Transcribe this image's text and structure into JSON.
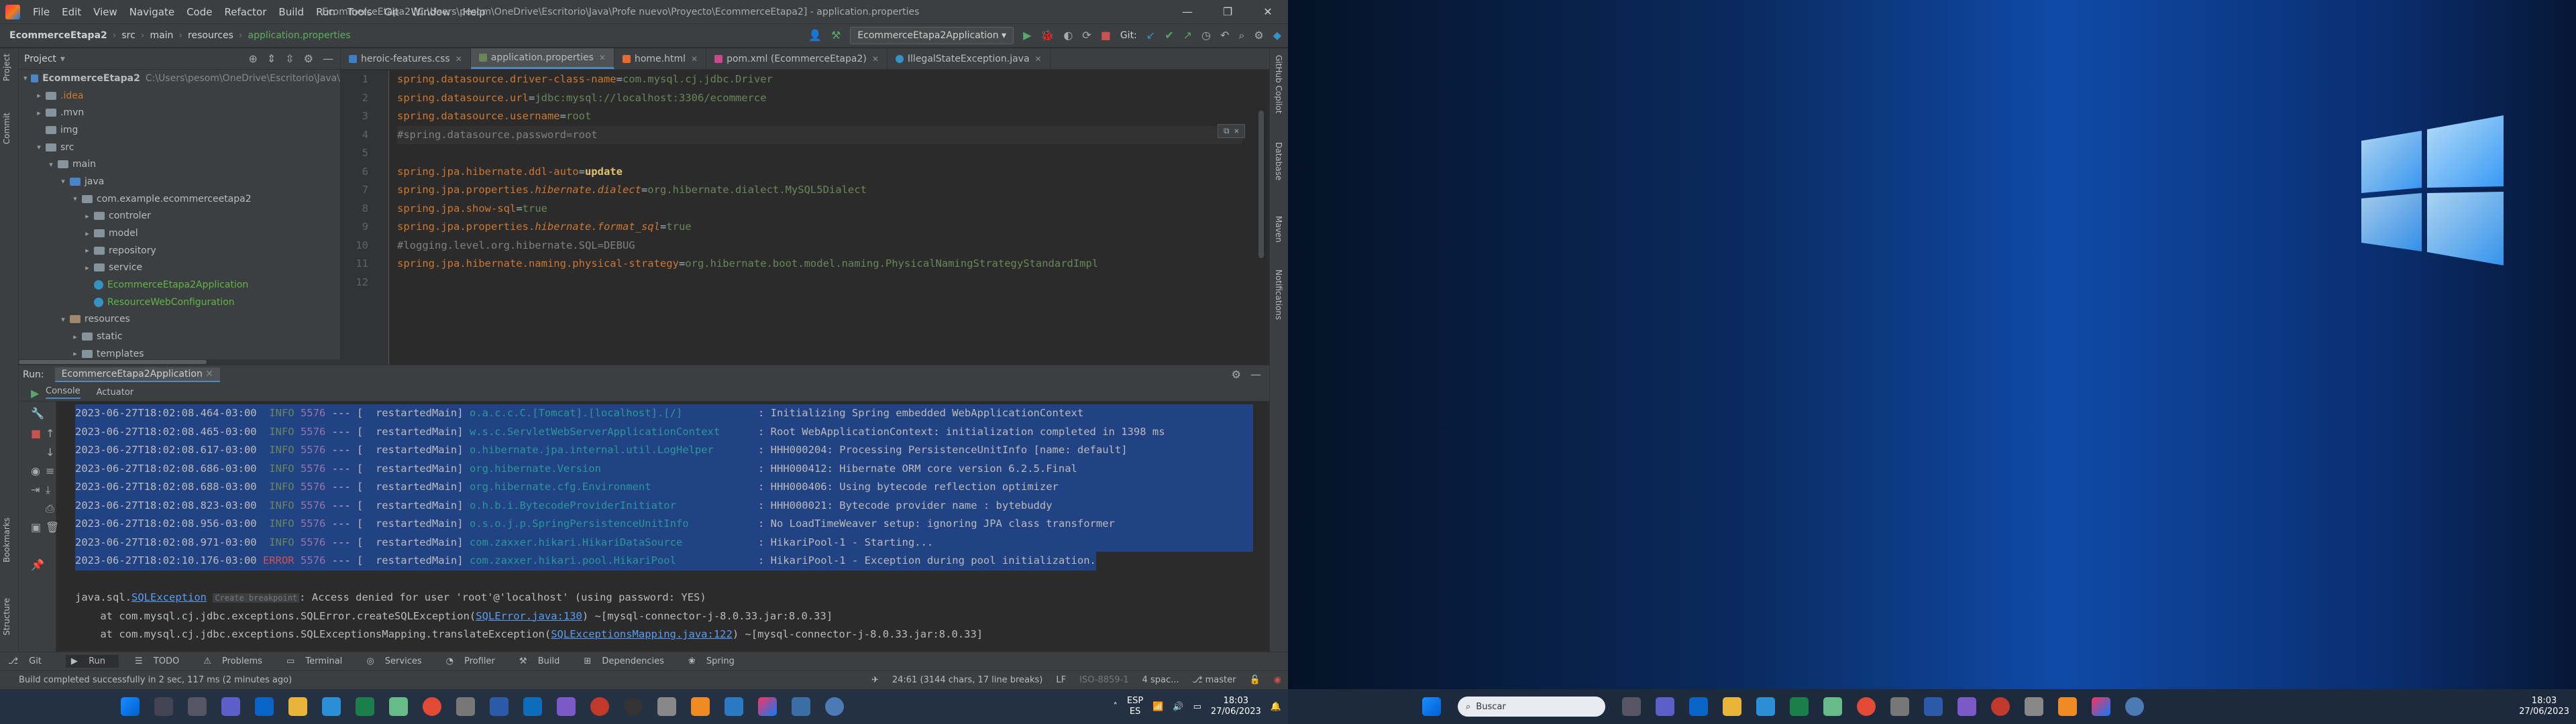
{
  "title_bar": {
    "menu": [
      "File",
      "Edit",
      "View",
      "Navigate",
      "Code",
      "Refactor",
      "Build",
      "Run",
      "Tools",
      "Git",
      "Window",
      "Help"
    ],
    "window_title": "EcommerceEtapa2 [C:\\Users\\pesom\\OneDrive\\Escritorio\\Java\\Profe nuevo\\Proyecto\\EcommerceEtapa2] - application.properties",
    "controls": [
      "—",
      "❐",
      "✕"
    ]
  },
  "navbar": {
    "breadcrumb": [
      "EcommerceEtapa2",
      "src",
      "main",
      "resources",
      "application.properties"
    ],
    "run_config": "EcommerceEtapa2Application",
    "git_label": "Git:"
  },
  "left_strip": [
    "Project",
    "Commit",
    "Bookmarks",
    "Structure"
  ],
  "right_strip": [
    "GitHub Copilot",
    "Database",
    "Maven",
    "Notifications"
  ],
  "project": {
    "title": "Project",
    "root": "EcommerceEtapa2",
    "root_path": "C:\\Users\\pesom\\OneDrive\\Escritorio\\Java\\",
    "items": [
      {
        "label": ".idea"
      },
      {
        "label": ".mvn"
      },
      {
        "label": "img"
      },
      {
        "label": "src"
      },
      {
        "label": "main"
      },
      {
        "label": "java"
      },
      {
        "label": "com.example.ecommerceetapa2"
      },
      {
        "label": "controler"
      },
      {
        "label": "model"
      },
      {
        "label": "repository"
      },
      {
        "label": "service"
      },
      {
        "label": "EcommerceEtapa2Application"
      },
      {
        "label": "ResourceWebConfiguration"
      },
      {
        "label": "resources"
      },
      {
        "label": "static"
      },
      {
        "label": "templates"
      }
    ]
  },
  "editor": {
    "tabs": [
      {
        "label": "heroic-features.css"
      },
      {
        "label": "application.properties"
      },
      {
        "label": "home.html"
      },
      {
        "label": "pom.xml (EcommerceEtapa2)"
      },
      {
        "label": "IllegalStateException.java"
      }
    ],
    "line_numbers": [
      "1",
      "2",
      "3",
      "4",
      "5",
      "6",
      "7",
      "8",
      "9",
      "10",
      "11",
      "12"
    ],
    "lines": [
      {
        "key": "spring.datasource.driver-class-name",
        "val": "com.mysql.cj.jdbc.Driver"
      },
      {
        "key": "spring.datasource.url",
        "val": "jdbc:mysql://localhost:3306/ecommerce"
      },
      {
        "key": "spring.datasource.username",
        "val": "root"
      },
      {
        "comment": "#spring.datasource.password=root"
      },
      {},
      {
        "key": "spring.jpa.hibernate.ddl-auto",
        "val": "update",
        "valbold": true
      },
      {
        "key": "spring.jpa.properties.",
        "keyital": "hibernate.dialect",
        "val": "org.hibernate.dialect.MySQL5Dialect"
      },
      {
        "key": "spring.jpa.show-sql",
        "val": "true"
      },
      {
        "key": "spring.jpa.properties.",
        "keyital": "hibernate.format_sql",
        "val": "true"
      },
      {
        "comment": "#logging.level.org.hibernate.SQL=DEBUG"
      },
      {
        "key": "spring.jpa.hibernate.naming.physical-strategy",
        "val": "org.hibernate.boot.model.naming.PhysicalNamingStrategyStandardImpl"
      },
      {}
    ]
  },
  "run": {
    "label": "Run:",
    "tab": "EcommerceEtapa2Application",
    "subtabs": [
      "Console",
      "Actuator"
    ],
    "log": [
      {
        "ts": "2023-06-27T18:02:08.464-03:00",
        "lvl": "INFO",
        "pid": "5576",
        "thr": "restartedMain",
        "logger": "o.a.c.c.C.[Tomcat].[localhost].[/]",
        "msg": ": Initializing Spring embedded WebApplicationContext"
      },
      {
        "ts": "2023-06-27T18:02:08.465-03:00",
        "lvl": "INFO",
        "pid": "5576",
        "thr": "restartedMain",
        "logger": "w.s.c.ServletWebServerApplicationContext",
        "msg": ": Root WebApplicationContext: initialization completed in 1398 ms"
      },
      {
        "ts": "2023-06-27T18:02:08.617-03:00",
        "lvl": "INFO",
        "pid": "5576",
        "thr": "restartedMain",
        "logger": "o.hibernate.jpa.internal.util.LogHelper",
        "msg": ": HHH000204: Processing PersistenceUnitInfo [name: default]"
      },
      {
        "ts": "2023-06-27T18:02:08.686-03:00",
        "lvl": "INFO",
        "pid": "5576",
        "thr": "restartedMain",
        "logger": "org.hibernate.Version",
        "msg": ": HHH000412: Hibernate ORM core version 6.2.5.Final"
      },
      {
        "ts": "2023-06-27T18:02:08.688-03:00",
        "lvl": "INFO",
        "pid": "5576",
        "thr": "restartedMain",
        "logger": "org.hibernate.cfg.Environment",
        "msg": ": HHH000406: Using bytecode reflection optimizer"
      },
      {
        "ts": "2023-06-27T18:02:08.823-03:00",
        "lvl": "INFO",
        "pid": "5576",
        "thr": "restartedMain",
        "logger": "o.h.b.i.BytecodeProviderInitiator",
        "msg": ": HHH000021: Bytecode provider name : bytebuddy"
      },
      {
        "ts": "2023-06-27T18:02:08.956-03:00",
        "lvl": "INFO",
        "pid": "5576",
        "thr": "restartedMain",
        "logger": "o.s.o.j.p.SpringPersistenceUnitInfo",
        "msg": ": No LoadTimeWeaver setup: ignoring JPA class transformer"
      },
      {
        "ts": "2023-06-27T18:02:08.971-03:00",
        "lvl": "INFO",
        "pid": "5576",
        "thr": "restartedMain",
        "logger": "com.zaxxer.hikari.HikariDataSource",
        "msg": ": HikariPool-1 - Starting..."
      },
      {
        "ts": "2023-06-27T18:02:10.176-03:00",
        "lvl": "ERROR",
        "pid": "5576",
        "thr": "restartedMain",
        "logger": "com.zaxxer.hikari.pool.HikariPool",
        "msg": ": HikariPool-1 - Exception during pool initialization."
      }
    ],
    "exception": {
      "prefix": "java.sql.",
      "cls": "SQLException",
      "bp": "Create breakpoint",
      "msg": ": Access denied for user 'root'@'localhost' (using password: YES)",
      "at1_pre": "    at com.mysql.cj.jdbc.exceptions.SQLError.createSQLException(",
      "at1_link": "SQLError.java:130",
      "at1_post": ") ~[mysql-connector-j-8.0.33.jar:8.0.33]",
      "at2_pre": "    at com.mysql.cj.jdbc.exceptions.SQLExceptionsMapping.translateException(",
      "at2_link": "SQLExceptionsMapping.java:122",
      "at2_post": ") ~[mysql-connector-j-8.0.33.jar:8.0.33]"
    }
  },
  "bottom_tools": [
    "Git",
    "Run",
    "TODO",
    "Problems",
    "Terminal",
    "Services",
    "Profiler",
    "Build",
    "Dependencies",
    "Spring"
  ],
  "status": {
    "message": "Build completed successfully in 2 sec, 117 ms (2 minutes ago)",
    "position": "24:61 (3144 chars, 17 line breaks)",
    "line_sep": "LF",
    "encoding": "ISO-8859-1",
    "indent": "4 spac...",
    "branch": "master"
  },
  "taskbar_left": {
    "lang": "ESP",
    "lang2": "ES",
    "time": "18:03",
    "date": "27/06/2023"
  },
  "taskbar_right": {
    "search_placeholder": "Buscar",
    "time": "18:03",
    "date": "27/06/2023"
  }
}
